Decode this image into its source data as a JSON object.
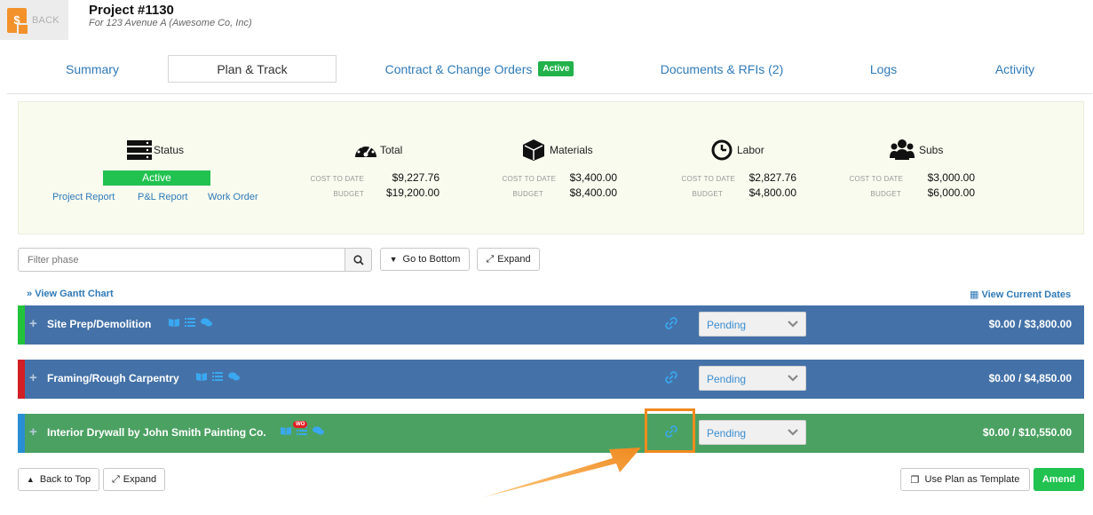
{
  "header": {
    "back_label": "BACK",
    "project_title": "Project #1130",
    "project_subtitle": "For 123 Avenue A (Awesome Co, Inc)"
  },
  "tabs": [
    {
      "label": "Summary"
    },
    {
      "label": "Plan & Track",
      "active": true
    },
    {
      "label": "Contract & Change Orders",
      "badge": "Active"
    },
    {
      "label": "Documents & RFIs (2)"
    },
    {
      "label": "Logs"
    },
    {
      "label": "Activity"
    }
  ],
  "summary": {
    "status": {
      "heading": "Status",
      "value": "Active",
      "links": [
        "Project Report",
        "P&L Report",
        "Work Order"
      ]
    },
    "cost_to_date_label": "COST TO DATE",
    "budget_label": "BUDGET",
    "total": {
      "heading": "Total",
      "cost_to_date": "$9,227.76",
      "budget": "$19,200.00"
    },
    "materials": {
      "heading": "Materials",
      "cost_to_date": "$3,400.00",
      "budget": "$8,400.00"
    },
    "labor": {
      "heading": "Labor",
      "cost_to_date": "$2,827.76",
      "budget": "$4,800.00"
    },
    "subs": {
      "heading": "Subs",
      "cost_to_date": "$3,000.00",
      "budget": "$6,000.00"
    }
  },
  "toolbar": {
    "filter_placeholder": "Filter phase",
    "go_to_bottom": "Go to Bottom",
    "expand": "Expand",
    "view_gantt": "View Gantt Chart",
    "view_current_dates": "View Current Dates"
  },
  "phases": [
    {
      "name": "Site Prep/Demolition",
      "status": "Pending",
      "amount": "$0.00 / $3,800.00",
      "edge_color": "#22c33b",
      "bg_color": "#4472a8"
    },
    {
      "name": "Framing/Rough Carpentry",
      "status": "Pending",
      "amount": "$0.00 / $4,850.00",
      "edge_color": "#d11f25",
      "bg_color": "#4472a8"
    },
    {
      "name": "Interior Drywall by John Smith Painting Co.",
      "status": "Pending",
      "amount": "$0.00 / $10,550.00",
      "edge_color": "#2a8ed4",
      "bg_color": "#4ba162",
      "wo_badge": "WO"
    }
  ],
  "footer": {
    "back_to_top": "Back to Top",
    "expand": "Expand",
    "use_plan_template": "Use Plan as Template",
    "amend": "Amend"
  }
}
